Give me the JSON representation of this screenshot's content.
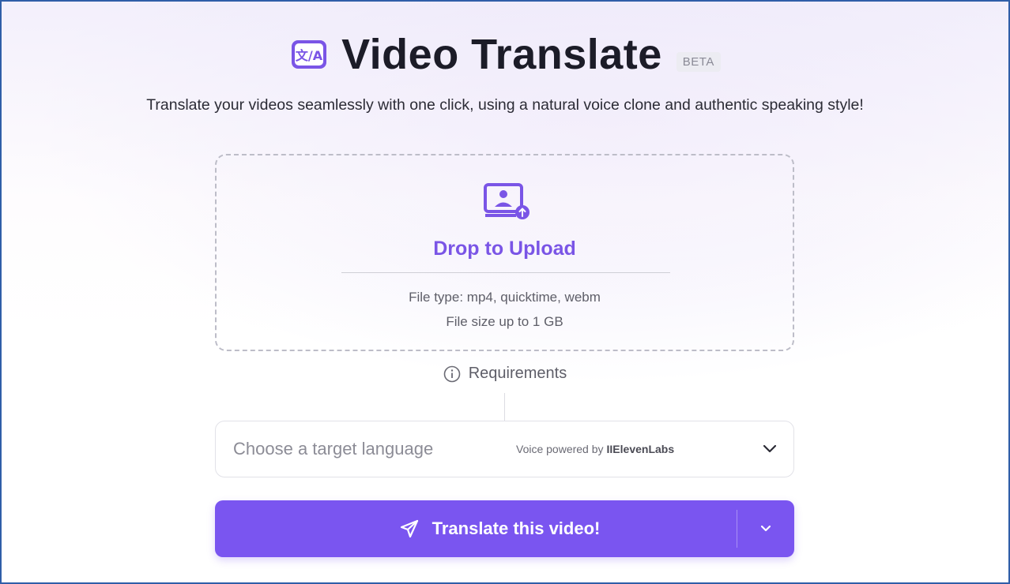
{
  "header": {
    "logo_glyph": "文/A",
    "title": "Video Translate",
    "badge": "BETA",
    "subtitle": "Translate your videos seamlessly with one click, using a natural voice clone and authentic speaking style!"
  },
  "upload": {
    "title": "Drop to Upload",
    "file_type": "File type: mp4, quicktime, webm",
    "file_size": "File size up to 1 GB",
    "icon": "upload-video-icon"
  },
  "requirements": {
    "label": "Requirements",
    "icon": "info-icon"
  },
  "language": {
    "placeholder": "Choose a target language",
    "voice_prefix": "Voice powered by",
    "voice_brand": "IIElevenLabs",
    "icon": "chevron-down-icon"
  },
  "translate": {
    "label": "Translate this video!",
    "icon": "send-icon"
  },
  "colors": {
    "accent": "#7a55f0",
    "upload_title": "#7a55e6",
    "title_text": "#1c1c28",
    "frame_border": "#2f5ea8"
  }
}
